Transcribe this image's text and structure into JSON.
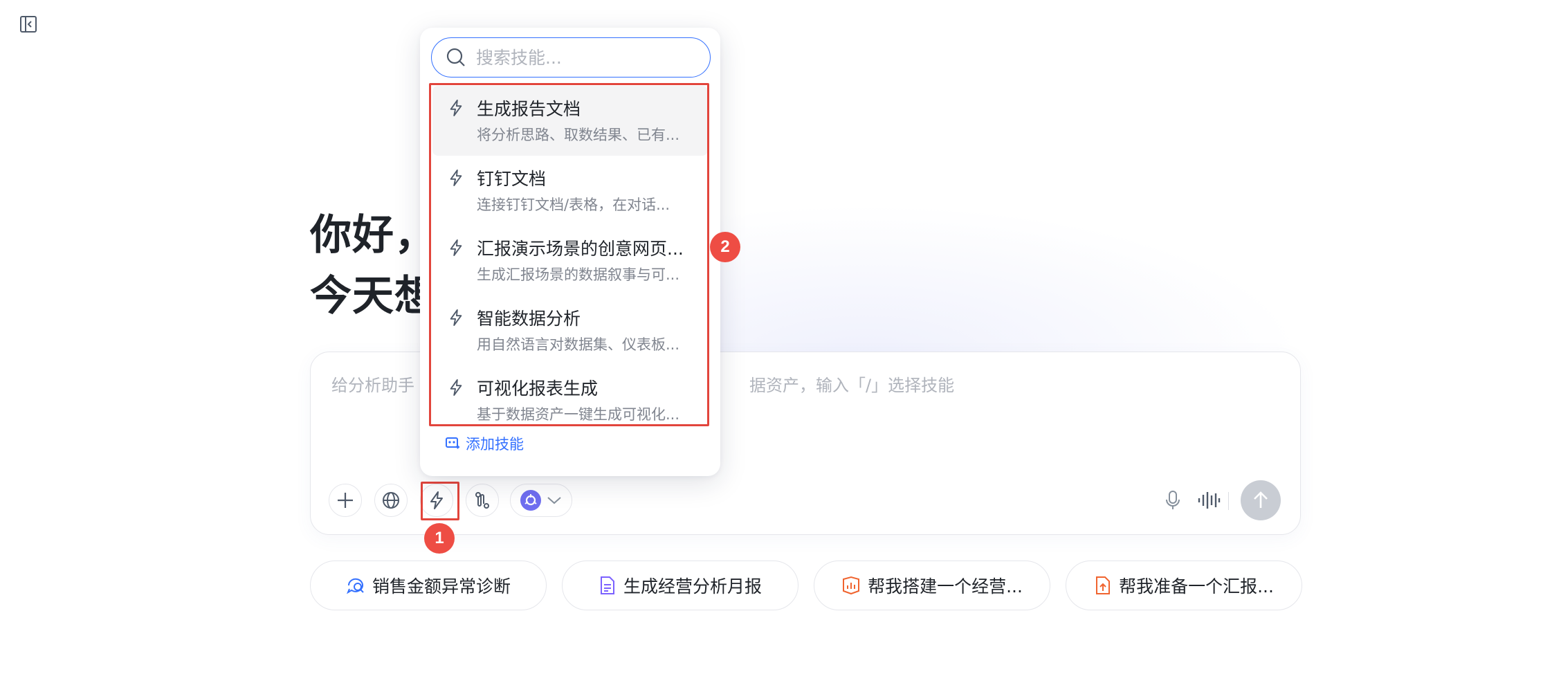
{
  "sidebar": {
    "toggle_icon": "sidebar-collapse-icon"
  },
  "greeting": {
    "line1": "你好，",
    "line2": "今天想"
  },
  "composer": {
    "placeholder_left": "给分析助手",
    "placeholder_right": "据资产，输入「/」选择技能",
    "tools": [
      {
        "name": "add-icon"
      },
      {
        "name": "globe-icon"
      },
      {
        "name": "lightning-icon"
      },
      {
        "name": "workflow-icon"
      },
      {
        "name": "model-logo-icon"
      }
    ]
  },
  "skill_popup": {
    "search_placeholder": "搜索技能...",
    "skills": [
      {
        "title": "生成报告文档",
        "desc": "将分析思路、取数结果、已有..."
      },
      {
        "title": "钉钉文档",
        "desc": "连接钉钉文档/表格，在对话..."
      },
      {
        "title": "汇报演示场景的创意网页...",
        "desc": "生成汇报场景的数据叙事与可..."
      },
      {
        "title": "智能数据分析",
        "desc": "用自然语言对数据集、仪表板..."
      },
      {
        "title": "可视化报表生成",
        "desc": "基于数据资产一键生成可视化..."
      }
    ],
    "add_skill_label": "添加技能"
  },
  "suggestions": [
    {
      "label": "销售金额异常诊断",
      "icon": "chat-analysis-icon",
      "color": "#3370ff"
    },
    {
      "label": "生成经营分析月报",
      "icon": "document-list-icon",
      "color": "#7b61ff"
    },
    {
      "label": "帮我搭建一个经营...",
      "icon": "dashboard-icon",
      "color": "#f0642f"
    },
    {
      "label": "帮我准备一个汇报...",
      "icon": "upload-file-icon",
      "color": "#f0642f"
    }
  ],
  "annotations": {
    "badge1": "1",
    "badge2": "2",
    "highlight_color": "#e2453c"
  }
}
